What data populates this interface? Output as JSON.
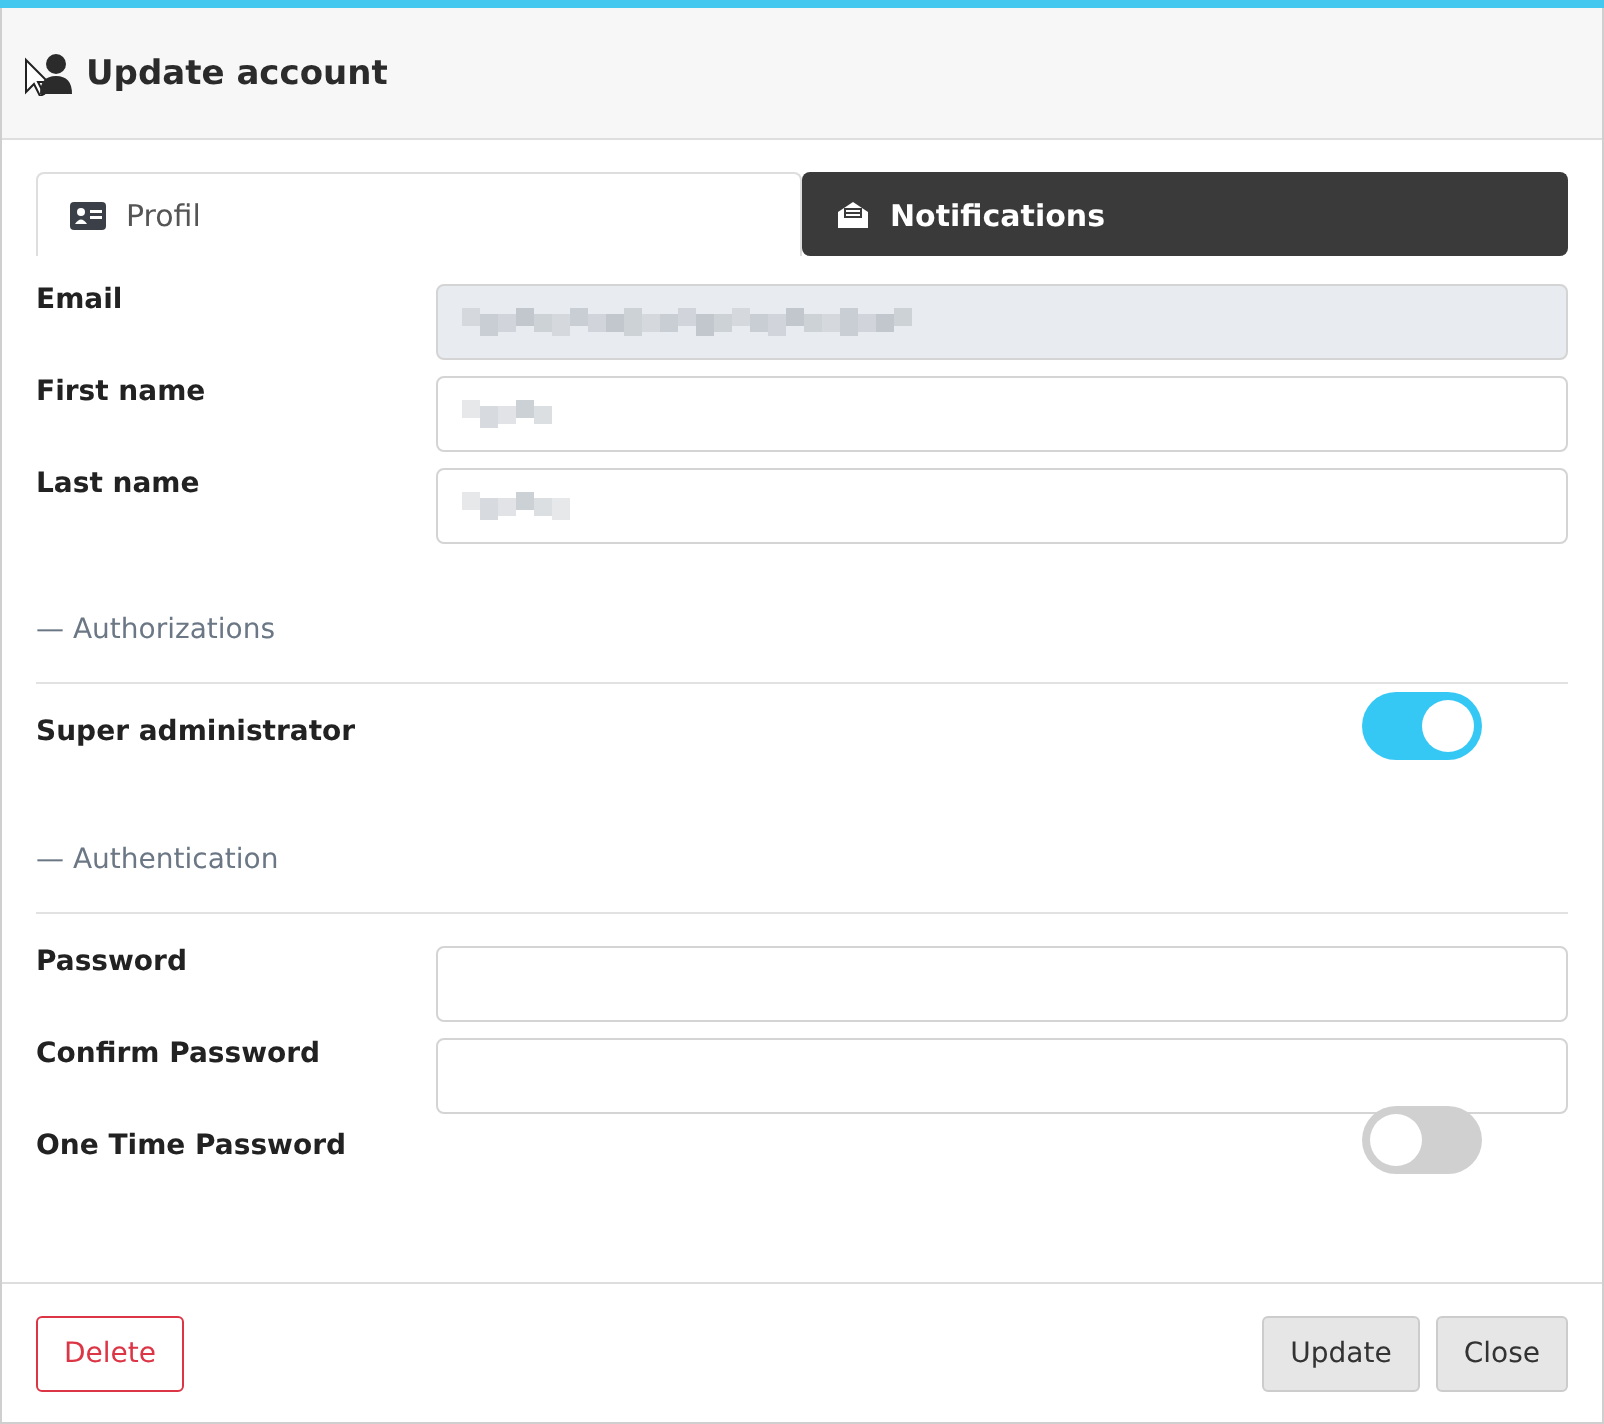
{
  "dialog": {
    "title": "Update account"
  },
  "tabs": [
    {
      "label": "Profil",
      "selected": true
    },
    {
      "label": "Notifications",
      "selected": false
    }
  ],
  "form": [
    {
      "kind": "field",
      "label": "Email",
      "disabled": true,
      "redacted": true
    },
    {
      "kind": "field",
      "label": "First name",
      "disabled": false,
      "redacted": true
    },
    {
      "kind": "field",
      "label": "Last name",
      "disabled": false,
      "redacted": true
    },
    {
      "kind": "section",
      "label": "— Authorizations"
    },
    {
      "kind": "toggle",
      "label": "Super administrator",
      "on": true
    },
    {
      "kind": "section",
      "label": "— Authentication"
    },
    {
      "kind": "field",
      "label": "Password",
      "disabled": false,
      "redacted": false
    },
    {
      "kind": "field",
      "label": "Confirm Password",
      "disabled": false,
      "redacted": false
    },
    {
      "kind": "toggle",
      "label": "One Time Password",
      "on": false
    }
  ],
  "footer": {
    "delete": "Delete",
    "buttons": [
      "Update",
      "Close"
    ]
  }
}
